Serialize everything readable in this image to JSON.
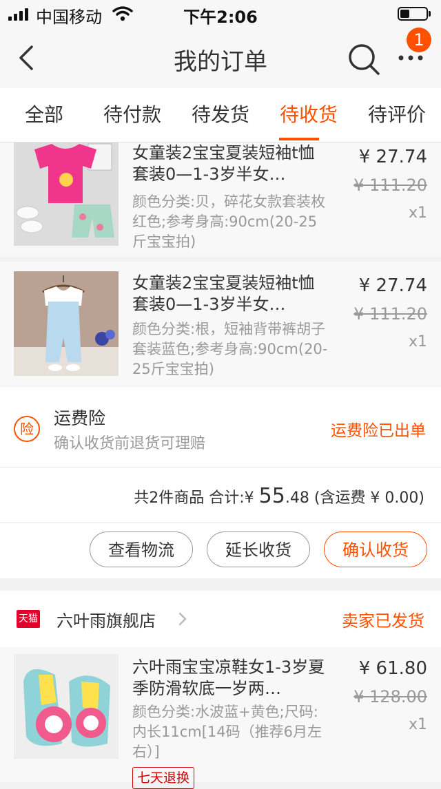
{
  "status_bar": {
    "carrier": "中国移动",
    "time": "下午2:06",
    "battery_level": 0.35
  },
  "nav": {
    "title": "我的订单",
    "badge_count": "1"
  },
  "tabs": [
    {
      "label": "全部"
    },
    {
      "label": "待付款"
    },
    {
      "label": "待发货"
    },
    {
      "label": "待收货",
      "active": true
    },
    {
      "label": "待评价"
    }
  ],
  "order1": {
    "items": [
      {
        "title": "女童装2宝宝夏装短袖t恤套装0—1-3岁半女…",
        "sku": "颜色分类:贝，碎花女款套装枚红色;参考身高:90cm(20-25斤宝宝拍)",
        "price": "¥ 27.74",
        "original_price": "¥ 111.20",
        "qty": "x1"
      },
      {
        "title": "女童装2宝宝夏装短袖t恤套装0—1-3岁半女…",
        "sku": "颜色分类:根，短袖背带裤胡子套装蓝色;参考身高:90cm(20-25斤宝宝拍)",
        "price": "¥ 27.74",
        "original_price": "¥ 111.20",
        "qty": "x1"
      }
    ],
    "insurance": {
      "icon_text": "险",
      "title": "运费险",
      "desc": "确认收货前退货可理赔",
      "status": "运费险已出单"
    },
    "summary": {
      "prefix": "共2件商品 合计:",
      "currency": "¥",
      "int": "55",
      "dec": ".48",
      "shipping": "(含运费 ¥ 0.00)"
    },
    "buttons": {
      "logistics": "查看物流",
      "extend": "延长收货",
      "confirm": "确认收货"
    }
  },
  "order2": {
    "shop": {
      "badge": "天猫",
      "name": "六叶雨旗舰店",
      "status": "卖家已发货"
    },
    "items": [
      {
        "title": "六叶雨宝宝凉鞋女1-3岁夏季防滑软底一岁两…",
        "sku": "颜色分类:水波蓝+黄色;尺码:内长11cm[14码（推荐6月左右）]",
        "price": "¥ 61.80",
        "original_price": "¥ 128.00",
        "qty": "x1",
        "tag": "七天退换"
      }
    ]
  },
  "colors": {
    "accent": "#ff5000",
    "tmall_red": "#e4002b",
    "muted_text": "#999999"
  },
  "icons": {
    "back": "chevron-left-icon",
    "search": "search-icon",
    "more": "more-dots-icon",
    "insurance": "insurance-badge-icon",
    "shop_arrow": "chevron-right-icon"
  }
}
